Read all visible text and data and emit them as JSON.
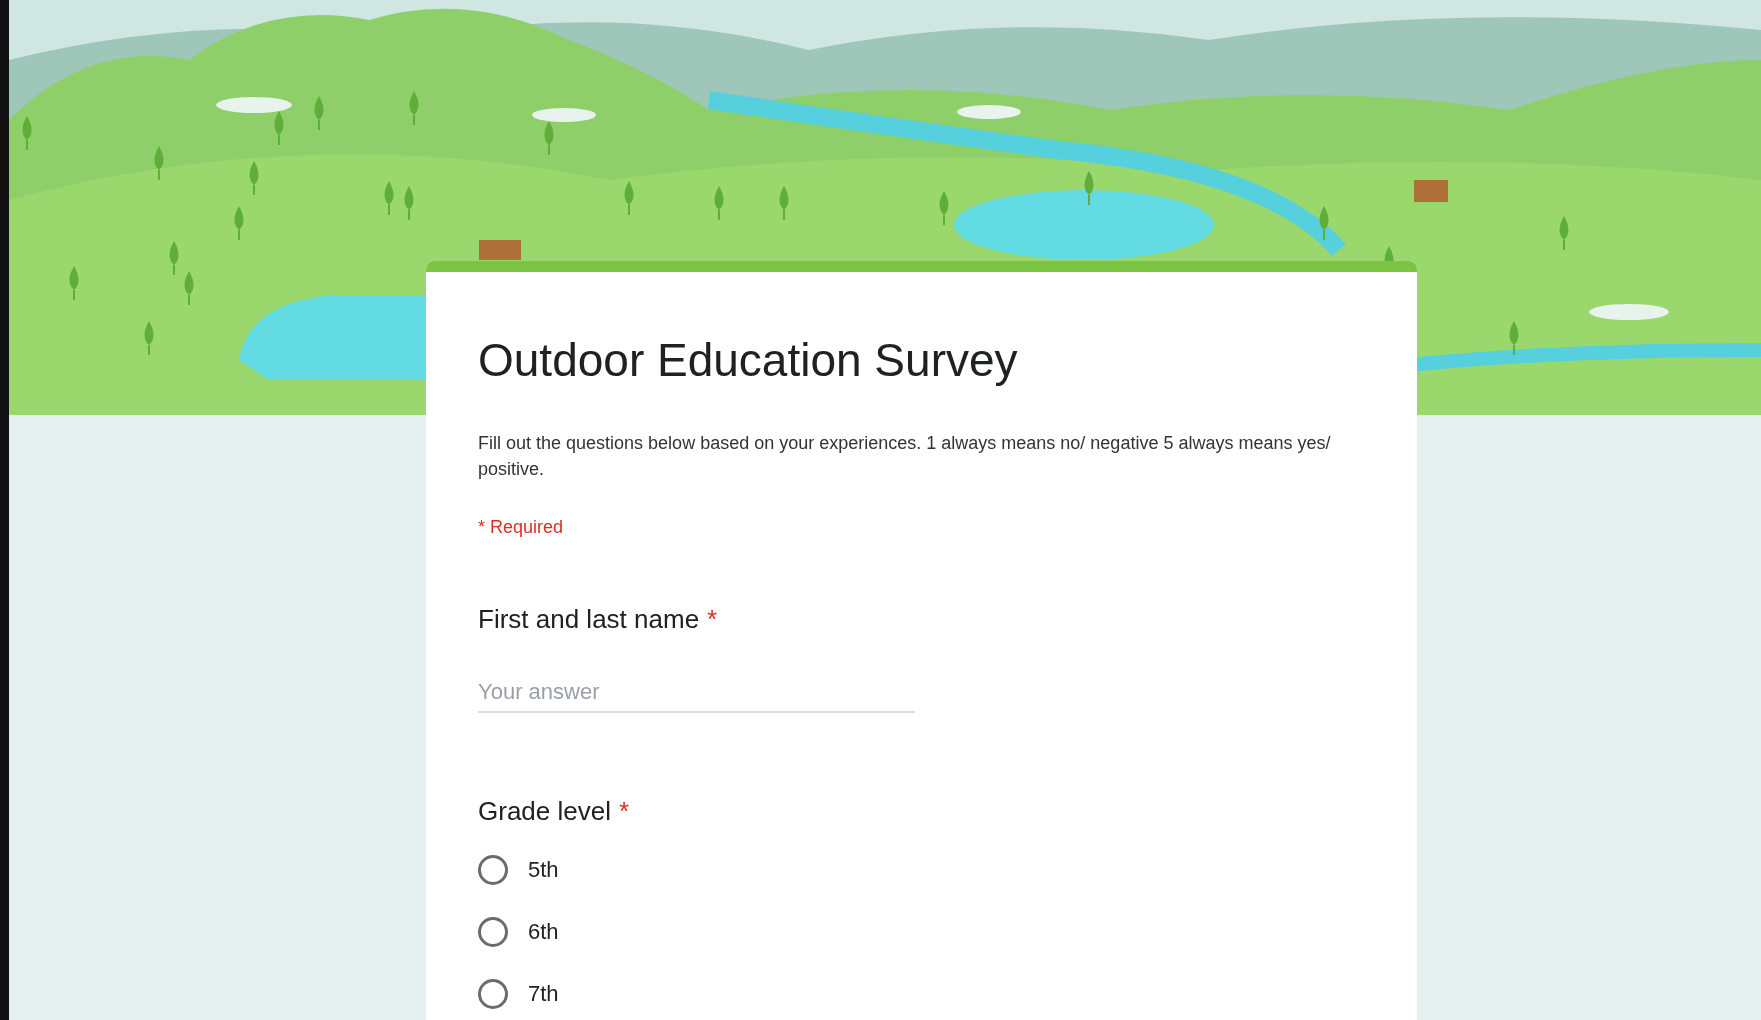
{
  "form": {
    "title": "Outdoor Education Survey",
    "description": "Fill out the questions below based on your experiences.  1 always means no/ negative 5 always means yes/ positive.",
    "required_note": "* Required"
  },
  "questions": [
    {
      "kind": "text",
      "label": "First and last name",
      "required_mark": "*",
      "placeholder": "Your answer"
    },
    {
      "kind": "radio",
      "label": "Grade level",
      "required_mark": "*",
      "options": [
        {
          "label": "5th",
          "selected": false
        },
        {
          "label": "6th",
          "selected": false
        },
        {
          "label": "7th",
          "selected": false
        }
      ]
    }
  ]
}
